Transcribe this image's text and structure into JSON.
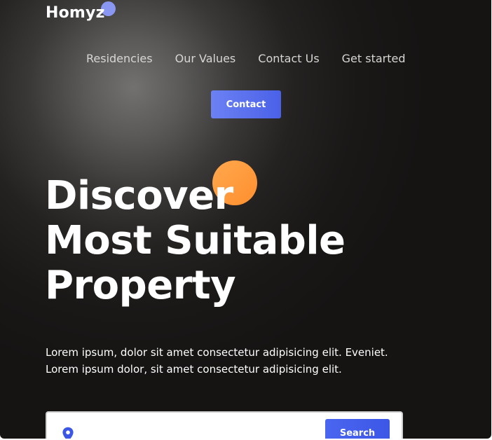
{
  "header": {
    "logo": "Homyz",
    "nav": [
      "Residencies",
      "Our Values",
      "Contact Us",
      "Get started"
    ],
    "contact_button": "Contact"
  },
  "hero": {
    "title_lines": [
      "Discover",
      "Most Suitable",
      "Property"
    ],
    "description_lines": [
      "Lorem ipsum, dolor sit amet consectetur adipisicing elit. Eveniet.",
      "Lorem ipsum dolor, sit amet consectetur adipisicing elit."
    ]
  },
  "search": {
    "icon": "location-pin-icon",
    "input_value": "",
    "button_label": "Search"
  },
  "colors": {
    "accent_blue": "#4a61e8",
    "logo_dot": "#8a97f2",
    "orange_circle": "#ff9a3e",
    "background_dark": "#151413"
  }
}
